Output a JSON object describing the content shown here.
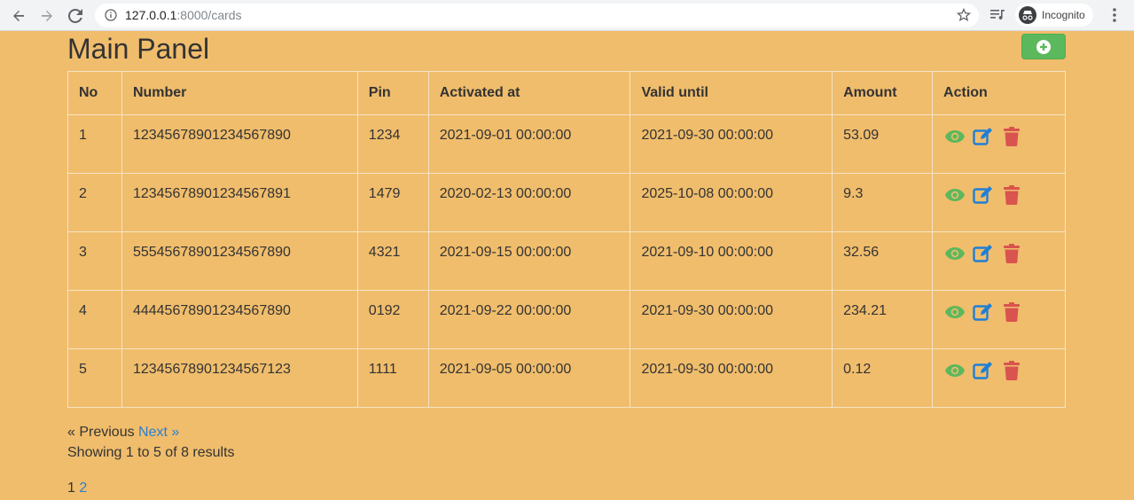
{
  "browser": {
    "url_host": "127.0.0.1",
    "url_rest": ":8000/cards",
    "incognito_label": "Incognito"
  },
  "page": {
    "title": "Main Panel",
    "add_icon": "plus-circle-icon"
  },
  "table": {
    "headers": [
      "No",
      "Number",
      "Pin",
      "Activated at",
      "Valid until",
      "Amount",
      "Action"
    ],
    "rows": [
      {
        "no": "1",
        "number": "12345678901234567890",
        "pin": "1234",
        "activated": "2021-09-01 00:00:00",
        "valid": "2021-09-30 00:00:00",
        "amount": "53.09"
      },
      {
        "no": "2",
        "number": "12345678901234567891",
        "pin": "1479",
        "activated": "2020-02-13 00:00:00",
        "valid": "2025-10-08 00:00:00",
        "amount": "9.3"
      },
      {
        "no": "3",
        "number": "55545678901234567890",
        "pin": "4321",
        "activated": "2021-09-15 00:00:00",
        "valid": "2021-09-10 00:00:00",
        "amount": "32.56"
      },
      {
        "no": "4",
        "number": "44445678901234567890",
        "pin": "0192",
        "activated": "2021-09-22 00:00:00",
        "valid": "2021-09-30 00:00:00",
        "amount": "234.21"
      },
      {
        "no": "5",
        "number": "12345678901234567123",
        "pin": "1111",
        "activated": "2021-09-05 00:00:00",
        "valid": "2021-09-30 00:00:00",
        "amount": "0.12"
      }
    ],
    "action_icons": [
      "eye-icon",
      "edit-icon",
      "trash-icon"
    ]
  },
  "pagination": {
    "previous": "« Previous",
    "next": "Next »",
    "summary": "Showing 1 to 5 of 8 results",
    "current_page": "1",
    "next_page": "2"
  },
  "colors": {
    "background": "#f0bd6c",
    "add_button": "#5cb85c",
    "view_icon": "#5cb85c",
    "edit_icon": "#1f7fd6",
    "delete_icon": "#d9534f",
    "link": "#2b7fcf"
  }
}
